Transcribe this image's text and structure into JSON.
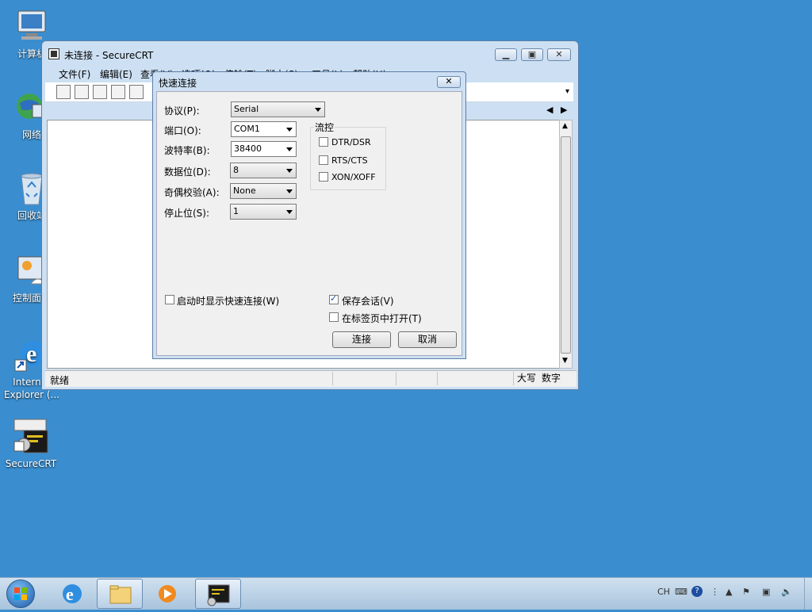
{
  "desktop": {
    "icons": [
      {
        "label": "计算机"
      },
      {
        "label": "网络"
      },
      {
        "label": "回收站"
      },
      {
        "label": "控制面板"
      },
      {
        "label": "Internet Explorer (..."
      },
      {
        "label": "SecureCRT"
      }
    ]
  },
  "window": {
    "title": "未连接 - SecureCRT",
    "minimize_icon": "minimize-icon",
    "maximize_icon": "maximize-icon",
    "close_icon": "close-icon",
    "menu": [
      "文件(F)",
      "编辑(E)",
      "查看(V)",
      "选项(O)",
      "传输(T)",
      "脚本(S)",
      "工具(L)",
      "帮助(H)"
    ],
    "status": {
      "left": "就绪",
      "caps": "大写",
      "num": "数字"
    }
  },
  "dialog": {
    "title": "快速连接",
    "protocol": {
      "label": "协议(P):",
      "value": "Serial"
    },
    "port": {
      "label": "端口(O):",
      "value": "COM1"
    },
    "baud": {
      "label": "波特率(B):",
      "value": "38400"
    },
    "databits": {
      "label": "数据位(D):",
      "value": "8"
    },
    "parity": {
      "label": "奇偶校验(A):",
      "value": "None"
    },
    "stopbits": {
      "label": "停止位(S):",
      "value": "1"
    },
    "flow": {
      "title": "流控",
      "options": [
        {
          "label": "DTR/DSR",
          "checked": false
        },
        {
          "label": "RTS/CTS",
          "checked": false
        },
        {
          "label": "XON/XOFF",
          "checked": false
        }
      ]
    },
    "show_on_startup": {
      "label": "启动时显示快速连接(W)",
      "checked": false
    },
    "save_session": {
      "label": "保存会话(V)",
      "checked": true
    },
    "open_in_tab": {
      "label": "在标签页中打开(T)",
      "checked": false
    },
    "connect_label": "连接",
    "cancel_label": "取消"
  },
  "taskbar": {
    "lang": "CH"
  }
}
